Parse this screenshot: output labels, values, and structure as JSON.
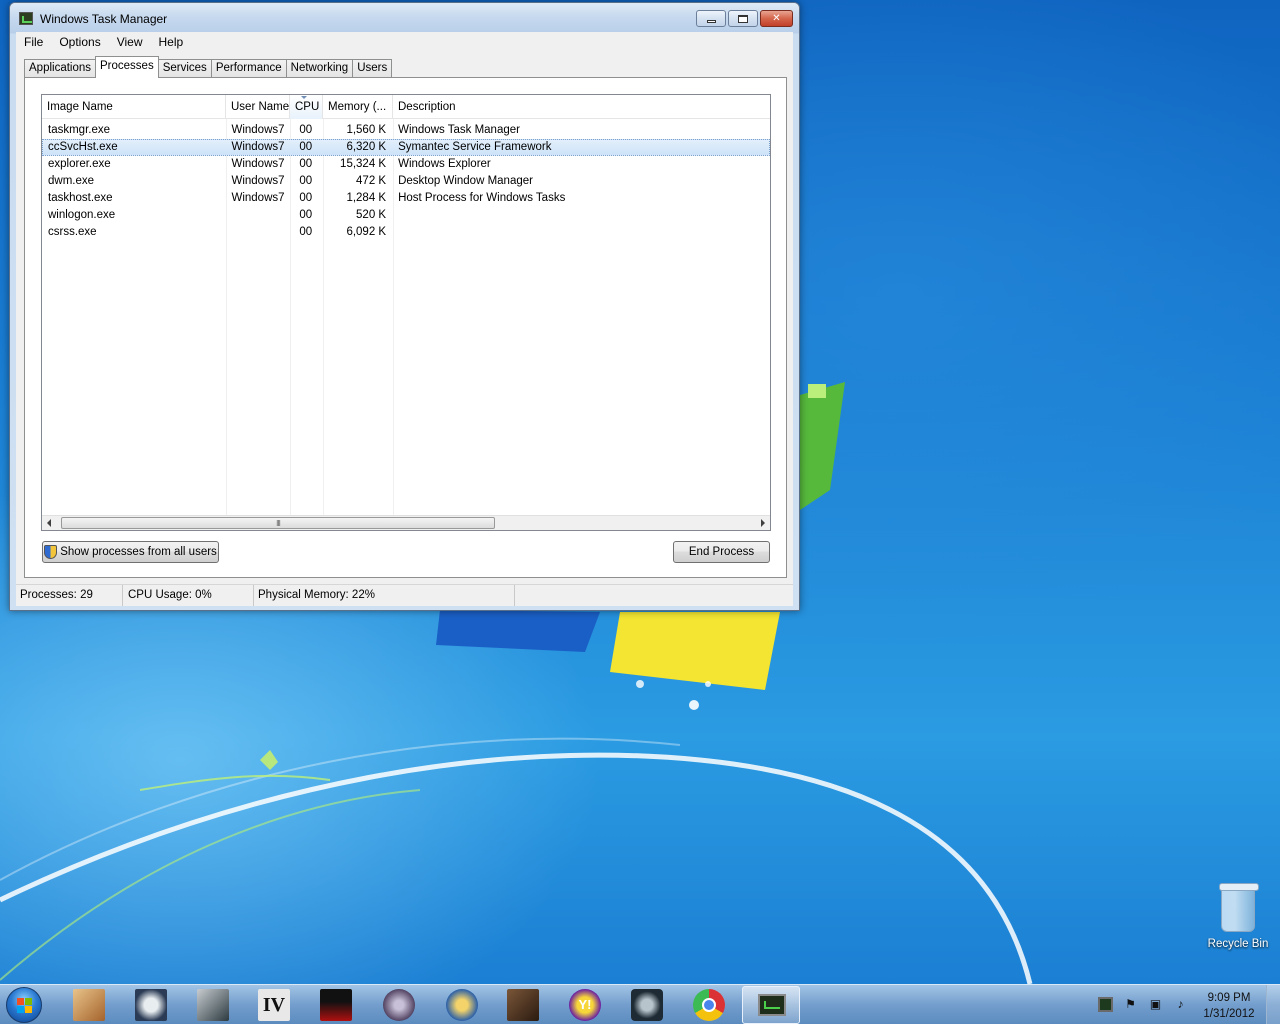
{
  "window": {
    "title": "Windows Task Manager",
    "menu": [
      "File",
      "Options",
      "View",
      "Help"
    ],
    "tabs": [
      "Applications",
      "Processes",
      "Services",
      "Performance",
      "Networking",
      "Users"
    ],
    "active_tab": "Processes"
  },
  "processes": {
    "columns": [
      "Image Name",
      "User Name",
      "CPU",
      "Memory (...",
      "Description"
    ],
    "sorted_column": "CPU",
    "rows": [
      {
        "name": "taskmgr.exe",
        "user": "Windows7",
        "cpu": "00",
        "memory": "1,560 K",
        "description": "Windows Task Manager"
      },
      {
        "name": "ccSvcHst.exe",
        "user": "Windows7",
        "cpu": "00",
        "memory": "6,320 K",
        "description": "Symantec Service Framework",
        "selected": true
      },
      {
        "name": "explorer.exe",
        "user": "Windows7",
        "cpu": "00",
        "memory": "15,324 K",
        "description": "Windows Explorer"
      },
      {
        "name": "dwm.exe",
        "user": "Windows7",
        "cpu": "00",
        "memory": "472 K",
        "description": "Desktop Window Manager"
      },
      {
        "name": "taskhost.exe",
        "user": "Windows7",
        "cpu": "00",
        "memory": "1,284 K",
        "description": "Host Process for Windows Tasks"
      },
      {
        "name": "winlogon.exe",
        "user": "",
        "cpu": "00",
        "memory": "520 K",
        "description": ""
      },
      {
        "name": "csrss.exe",
        "user": "",
        "cpu": "00",
        "memory": "6,092 K",
        "description": ""
      }
    ],
    "show_all_label": "Show processes from all users",
    "end_process_label": "End Process",
    "scroll_grip": "III"
  },
  "status": {
    "processes": "Processes: 29",
    "cpu": "CPU Usage: 0%",
    "memory": "Physical Memory: 22%"
  },
  "desktop": {
    "recycle_bin_label": "Recycle Bin"
  },
  "taskbar": {
    "pinned_icons": [
      "game-icon",
      "skull-icon",
      "crysis-icon",
      "gta-iv-icon",
      "noir-icon",
      "emblem-icon",
      "vault-boy-icon",
      "portrait-icon",
      "yahoo-messenger-icon",
      "steam-icon",
      "chrome-icon",
      "task-manager-icon"
    ],
    "gta_label": "IV",
    "yahoo_label": "Y!",
    "time": "9:09 PM",
    "date": "1/31/2012"
  },
  "colors": {
    "selection": "#cde3f8",
    "desktop_blue": "#1b7fd3"
  }
}
